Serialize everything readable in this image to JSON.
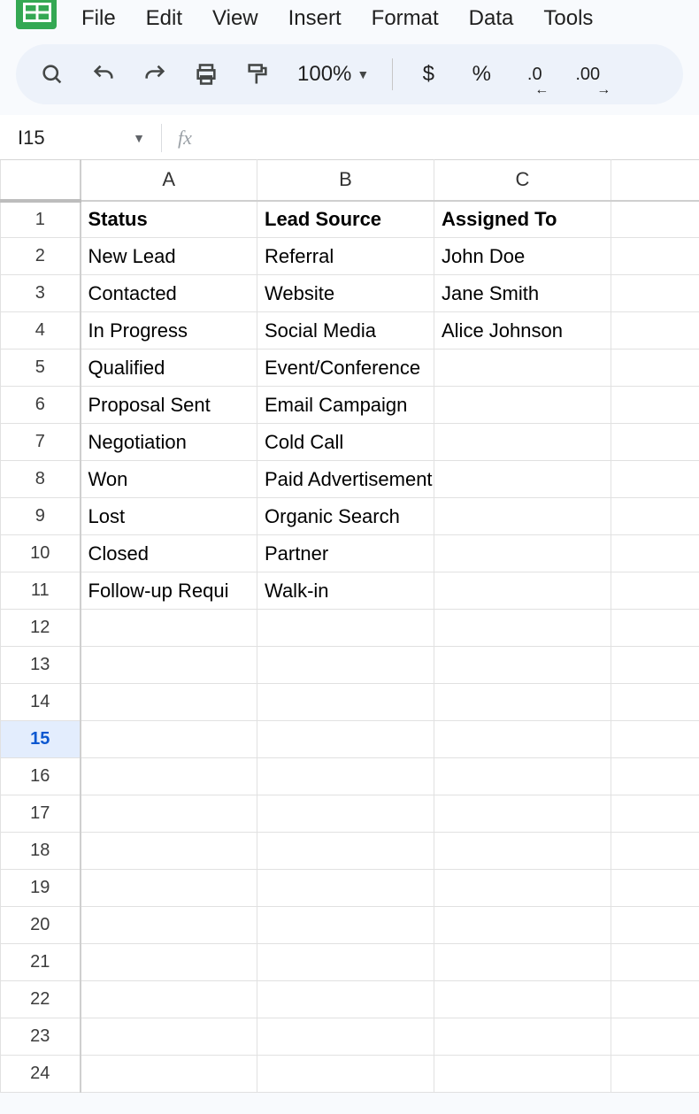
{
  "menu": {
    "file": "File",
    "edit": "Edit",
    "view": "View",
    "insert": "Insert",
    "format": "Format",
    "data": "Data",
    "tools": "Tools"
  },
  "toolbar": {
    "zoom": "100%",
    "currency": "$",
    "percent": "%",
    "dec_decrease": ".0",
    "dec_increase": ".00"
  },
  "namebox": {
    "cell_ref": "I15",
    "fx_label": "fx"
  },
  "columns": [
    "A",
    "B",
    "C",
    ""
  ],
  "active_row": 15,
  "total_rows": 24,
  "headers": {
    "A": "Status",
    "B": "Lead Source",
    "C": "Assigned To"
  },
  "rows": [
    {
      "A": "New Lead",
      "B": "Referral",
      "C": "John Doe"
    },
    {
      "A": "Contacted",
      "B": "Website",
      "C": "Jane Smith"
    },
    {
      "A": "In Progress",
      "B": "Social Media",
      "C": "Alice Johnson"
    },
    {
      "A": "Qualified",
      "B": "Event/Conference",
      "C": ""
    },
    {
      "A": "Proposal Sent",
      "B": "Email Campaign",
      "C": ""
    },
    {
      "A": "Negotiation",
      "B": "Cold Call",
      "C": ""
    },
    {
      "A": "Won",
      "B": "Paid Advertisement",
      "C": ""
    },
    {
      "A": "Lost",
      "B": "Organic Search",
      "C": ""
    },
    {
      "A": "Closed",
      "B": "Partner",
      "C": ""
    },
    {
      "A": "Follow-up Requi",
      "B": "Walk-in",
      "C": ""
    }
  ]
}
